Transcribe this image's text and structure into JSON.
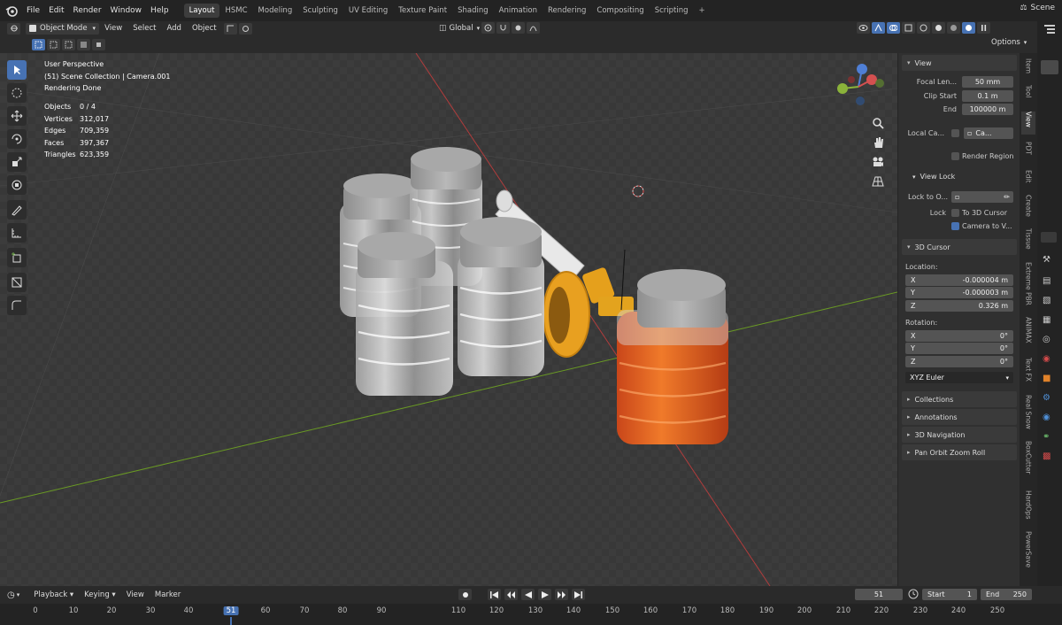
{
  "menu": [
    "File",
    "Edit",
    "Render",
    "Window",
    "Help"
  ],
  "workspaces": [
    "Layout",
    "HSMC",
    "Modeling",
    "Sculpting",
    "UV Editing",
    "Texture Paint",
    "Shading",
    "Animation",
    "Rendering",
    "Compositing",
    "Scripting",
    "+"
  ],
  "scene_label": "Scene",
  "header": {
    "mode": "Object Mode",
    "view": "View",
    "select": "Select",
    "add": "Add",
    "object": "Object",
    "transform": "Global",
    "options": "Options"
  },
  "overlay": {
    "line1": "User Perspective",
    "line2": "(51) Scene Collection | Camera.001",
    "line3": "Rendering Done"
  },
  "stats": [
    {
      "k": "Objects",
      "v": "0 / 4"
    },
    {
      "k": "Vertices",
      "v": "312,017"
    },
    {
      "k": "Edges",
      "v": "709,359"
    },
    {
      "k": "Faces",
      "v": "397,367"
    },
    {
      "k": "Triangles",
      "v": "623,359"
    }
  ],
  "npanel": {
    "view_title": "View",
    "focal_label": "Focal Len...",
    "focal_value": "50 mm",
    "clip_start_label": "Clip Start",
    "clip_start_value": "0.1 m",
    "end_label": "End",
    "end_value": "100000 m",
    "local_camera_label": "Local Ca...",
    "local_camera_value": "Ca...",
    "render_region": "Render Region",
    "view_lock_title": "View Lock",
    "lock_to_label": "Lock to O...",
    "lock_label": "Lock",
    "to_3d_cursor": "To 3D Cursor",
    "camera_to_view": "Camera to V...",
    "cursor_title": "3D Cursor",
    "location_label": "Location:",
    "x_label": "X",
    "y_label": "Y",
    "z_label": "Z",
    "loc_x": "-0.000004 m",
    "loc_y": "-0.000003 m",
    "loc_z": "0.326 m",
    "rotation_label": "Rotation:",
    "rot_x": "0°",
    "rot_y": "0°",
    "rot_z": "0°",
    "rotation_mode": "XYZ Euler",
    "collections": "Collections",
    "annotations": "Annotations",
    "navigation": "3D Navigation",
    "pan_orbit": "Pan Orbit Zoom Roll"
  },
  "vtabs": [
    "Item",
    "Tool",
    "View",
    "PDT",
    "Edit",
    "Create",
    "Tissue",
    "Extreme PBR",
    "ANIMAX",
    "Text FX",
    "Real Snow",
    "BoxCutter",
    "HardOps",
    "PowerSave"
  ],
  "timeline": {
    "playback": "Playback",
    "keying": "Keying",
    "view": "View",
    "marker": "Marker",
    "current_frame": "51",
    "start_label": "Start",
    "start_value": "1",
    "end_label": "End",
    "end_value": "250"
  },
  "ruler_ticks": [
    "0",
    "10",
    "20",
    "30",
    "40",
    "51",
    "60",
    "70",
    "80",
    "90",
    "110",
    "120",
    "130",
    "140",
    "150",
    "160",
    "170",
    "180",
    "190",
    "200",
    "210",
    "220",
    "230",
    "240",
    "250"
  ],
  "colors": {
    "accent": "#4772b3",
    "x_axis": "#b03c3c",
    "y_axis": "#6a9a24",
    "amber": "#e0641a",
    "lid_yellow": "#e8a020"
  }
}
